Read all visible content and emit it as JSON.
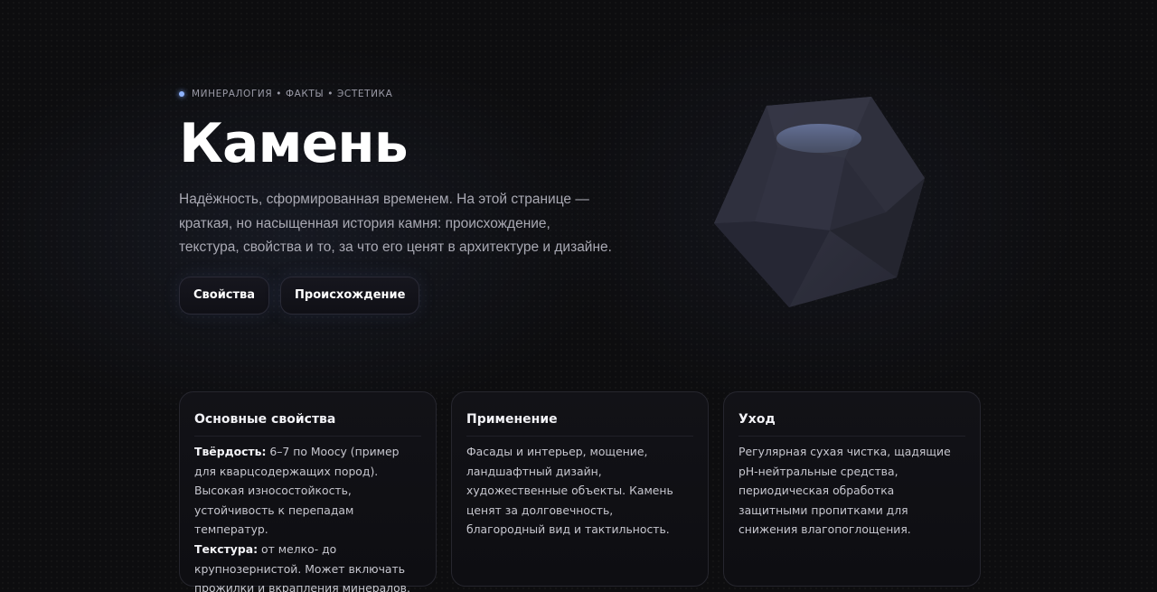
{
  "hero": {
    "eyebrow": "МИНЕРАЛОГИЯ • ФАКТЫ • ЭСТЕТИКА",
    "title": "Камень",
    "lead": "Надёжность, сформированная временем. На этой странице — краткая, но насыщенная история камня: происхождение, текстура, свойства и то, за что его ценят в архитектуре и дизайне.",
    "buttons": {
      "properties": "Свойства",
      "origin": "Происхождение"
    }
  },
  "cards": {
    "properties": {
      "title": "Основные свойства",
      "hardness_label": "Твёрдость:",
      "hardness_text": " 6–7 по Моосу (пример для кварцсодержащих пород). Высокая износостойкость, устойчивость к перепадам температур.",
      "texture_label": "Текстура:",
      "texture_text": " от мелко- до крупнозернистой. Может включать прожилки и вкрапления минералов."
    },
    "usage": {
      "title": "Применение",
      "text": "Фасады и интерьер, мощение, ландшафтный дизайн, художественные объекты. Камень ценят за долговечность, благородный вид и тактильность."
    },
    "care": {
      "title": "Уход",
      "text": "Регулярная сухая чистка, щадящие pH-нейтральные средства, периодическая обработка защитными пропитками для снижения влагопоглощения."
    }
  },
  "colors": {
    "background": "#0d0d0f",
    "accent": "#8fb4ff",
    "stone": "#2e2f3b"
  }
}
